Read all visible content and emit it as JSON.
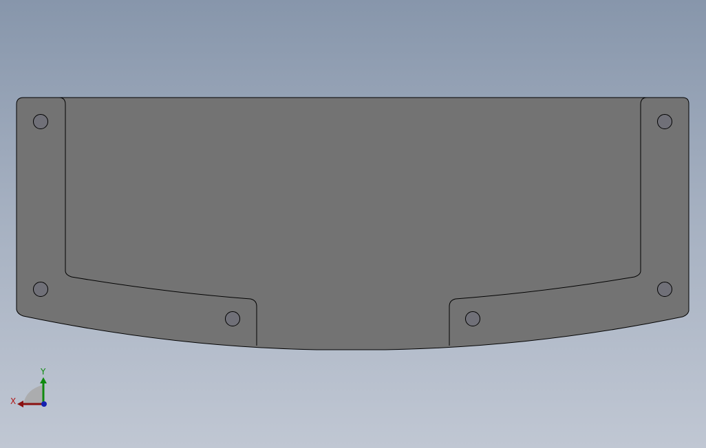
{
  "viewport": {
    "background_top": "#8796ab",
    "background_bottom": "#c0c7d3"
  },
  "part": {
    "fill_color": "#737373",
    "edge_color": "#000000",
    "hole_fill": "#707078",
    "hole_count": 6
  },
  "triad": {
    "x_label": "X",
    "y_label": "Y",
    "x_axis_color": "#8a1010",
    "y_axis_color": "#0f8a0f",
    "z_axis_color": "#1520b0"
  }
}
